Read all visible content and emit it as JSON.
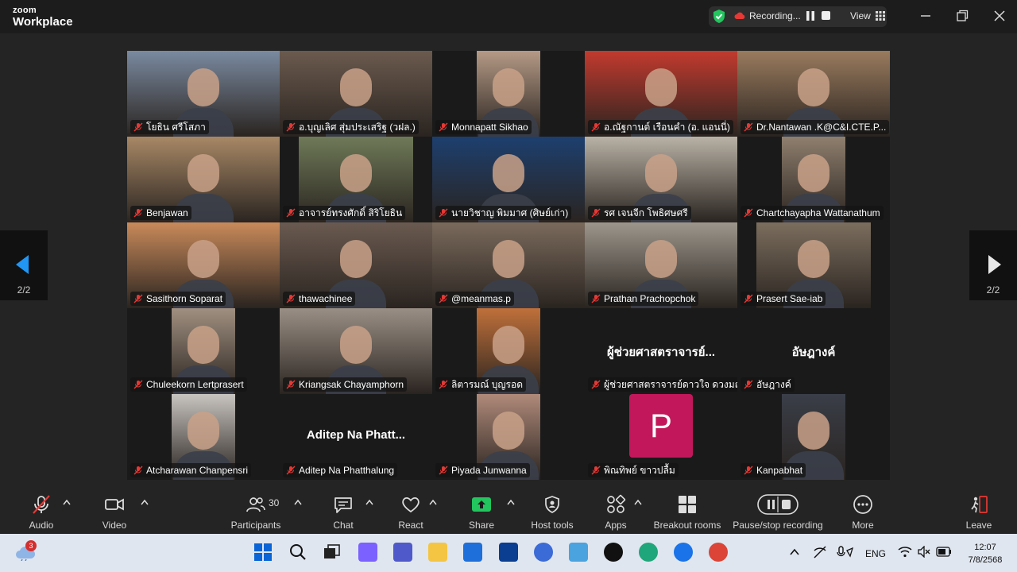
{
  "app": {
    "logo_line1": "zoom",
    "logo_line2": "Workplace"
  },
  "header": {
    "recording_label": "Recording...",
    "view_label": "View"
  },
  "colors": {
    "record_green": "#22c55e",
    "toolbar_bg": "#242424",
    "share_green": "#22c55e",
    "avatar_pink": "#c2185b",
    "mute_red": "#e53935"
  },
  "nav": {
    "left_page": "2/2",
    "right_page": "2/2"
  },
  "participants": [
    {
      "name": "โยธิน ศรีโสภา",
      "bg": "#7a8aa0",
      "vw": 192
    },
    {
      "name": "อ.บุญเลิศ สุ่มประเสริฐ (วฝล.)",
      "bg": "#6b5a4e",
      "vw": 192
    },
    {
      "name": "Monnapatt Sikhao",
      "bg": "#b59a86",
      "vw": 80
    },
    {
      "name": "อ.ณัฐกานต์ เรือนคำ (อ. แอนนี่)",
      "bg": "#c23a2e",
      "vw": 192
    },
    {
      "name": "Dr.Nantawan .K@C&I.CTE.P...",
      "bg": "#9a7b5e",
      "vw": 192
    },
    {
      "name": "Benjawan",
      "bg": "#a88866",
      "vw": 192
    },
    {
      "name": "อาจารย์ทรงศักดิ์ สิริโยธิน",
      "bg": "#6f7a58",
      "vw": 144
    },
    {
      "name": "นายวิชาญ พิมมาศ (ศิษย์เก่า)",
      "bg": "#1d3f6e",
      "vw": 192
    },
    {
      "name": "รศ เจนจีก โพธิศษศรี",
      "bg": "#b9b2a6",
      "vw": 192
    },
    {
      "name": "Chartchayapha Wattanathum",
      "bg": "#8f7f6e",
      "vw": 80
    },
    {
      "name": "Sasithorn Soparat",
      "bg": "#c98a5a",
      "vw": 192
    },
    {
      "name": "thawachinee",
      "bg": "#6a5a50",
      "vw": 192
    },
    {
      "name": "@meanmas.p",
      "bg": "#7a6a5c",
      "vw": 192
    },
    {
      "name": "Prathan Prachopchok",
      "bg": "#9c968c",
      "vw": 192
    },
    {
      "name": "Prasert Sae-iab",
      "bg": "#7c6e5e",
      "vw": 144
    },
    {
      "name": "Chuleekorn Lertprasert",
      "bg": "#a09080",
      "vw": 80
    },
    {
      "name": "Kriangsak Chayamphorn",
      "bg": "#9a8f85",
      "vw": 192
    },
    {
      "name": "ลิตารมณ์ บุญรอด",
      "bg": "#c0703a",
      "vw": 80
    },
    {
      "name": "ผู้ช่วยศาสตราจารย์ดาวใจ ดวงมณี",
      "big": "ผู้ช่วยศาสตราจารย์...",
      "bg": "",
      "vw": 0
    },
    {
      "name": "อัษฎางค์",
      "big": "อัษฎางค์",
      "bg": "",
      "vw": 0
    },
    {
      "name": "Atcharawan Chanpensri",
      "bg": "#c8c4c0",
      "vw": 80
    },
    {
      "name": "Aditep Na Phatthalung",
      "big": "Aditep Na Phatt...",
      "bg": "",
      "vw": 0
    },
    {
      "name": "Piyada Junwanna",
      "bg": "#b08a7a",
      "vw": 80
    },
    {
      "name": "พิณทิพย์ ขาวปลื้ม",
      "avatar": "P",
      "bg": "",
      "vw": 0
    },
    {
      "name": "Kanpabhat",
      "bg": "#3a3e48",
      "vw": 80
    }
  ],
  "toolbar": {
    "audio": "Audio",
    "video": "Video",
    "participants": "Participants",
    "participants_count": "30",
    "chat": "Chat",
    "react": "React",
    "share": "Share",
    "host_tools": "Host tools",
    "apps": "Apps",
    "breakout": "Breakout rooms",
    "pause_stop": "Pause/stop recording",
    "more": "More",
    "leave": "Leave"
  },
  "taskbar": {
    "weather_badge": "3",
    "lang": "ENG",
    "time": "12:07",
    "date": "7/8/2568"
  }
}
